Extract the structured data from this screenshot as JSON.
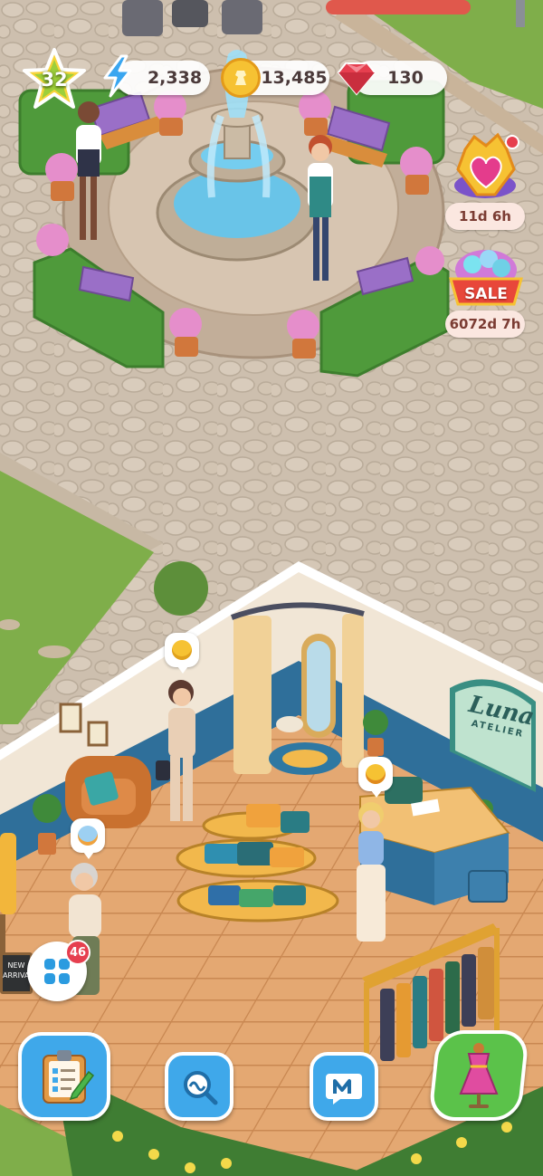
{
  "hud": {
    "level": "32",
    "energy": "2,338",
    "coins": "13,485",
    "gems": "130"
  },
  "events": [
    {
      "icon": "heart-event-icon",
      "timer": "11d 6h"
    },
    {
      "icon": "sale-event-icon",
      "label": "SALE",
      "timer": "6072d 7h"
    }
  ],
  "shop": {
    "sign_line1": "Luna",
    "sign_line2": "ATELIER",
    "chalkboard_line1": "NEW",
    "chalkboard_line2": "ARRIVALS"
  },
  "menu": {
    "badge_count": "46"
  },
  "colors": {
    "cobblestone": "#cdbfae",
    "grass": "#7fae4a",
    "floor": "#e2a56f",
    "wall_blue": "#2f6f9a",
    "accent_red": "#e63f4f"
  }
}
